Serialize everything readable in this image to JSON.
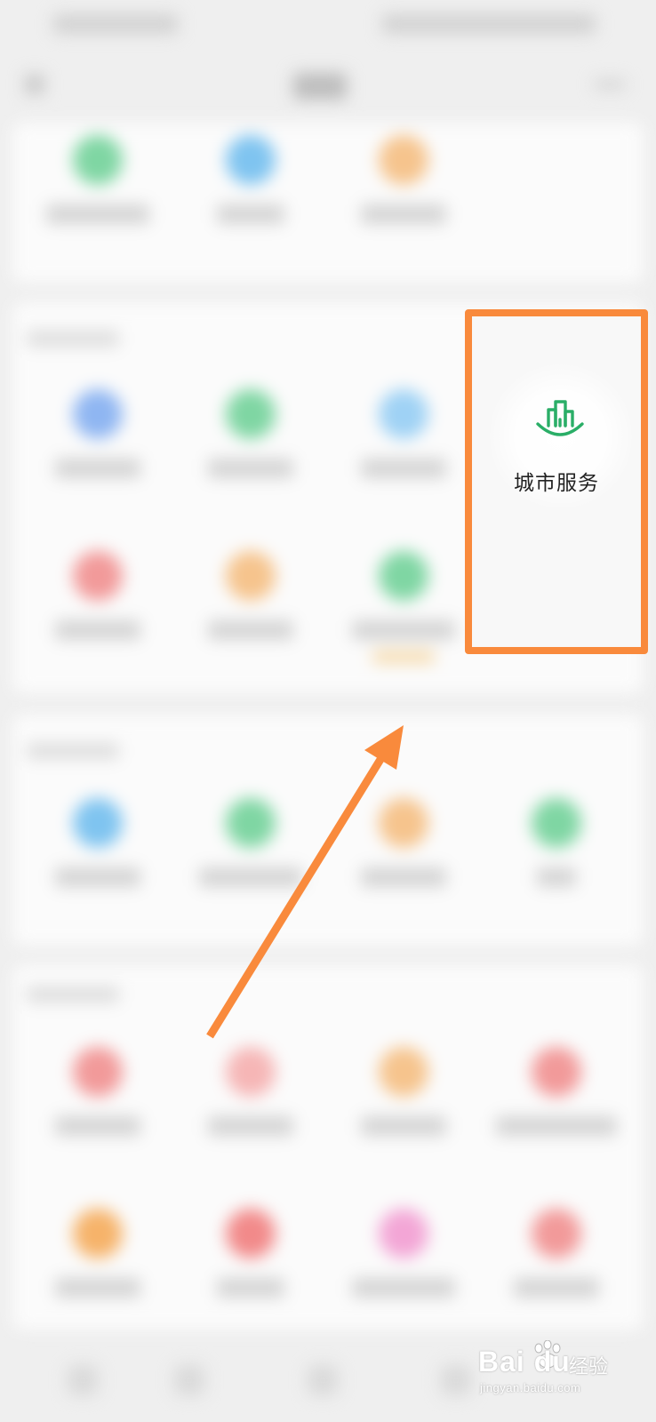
{
  "highlighted_entry": {
    "label": "城市服务",
    "icon": "city-building-icon",
    "icon_color": "#2aae67"
  },
  "annotation": {
    "frame_color": "#f98a3c",
    "arrow_color": "#f98a3c"
  },
  "watermark": {
    "brand": "Bai du",
    "suffix": "经验",
    "url": "jingyan.baidu.com"
  },
  "colors": {
    "background": "#efefef",
    "card": "#fbfbfb",
    "green": "#7fd6a3",
    "blue": "#7fc4f0",
    "orange": "#f6c48d",
    "red": "#f29a9a",
    "pink": "#f3a6d6"
  }
}
